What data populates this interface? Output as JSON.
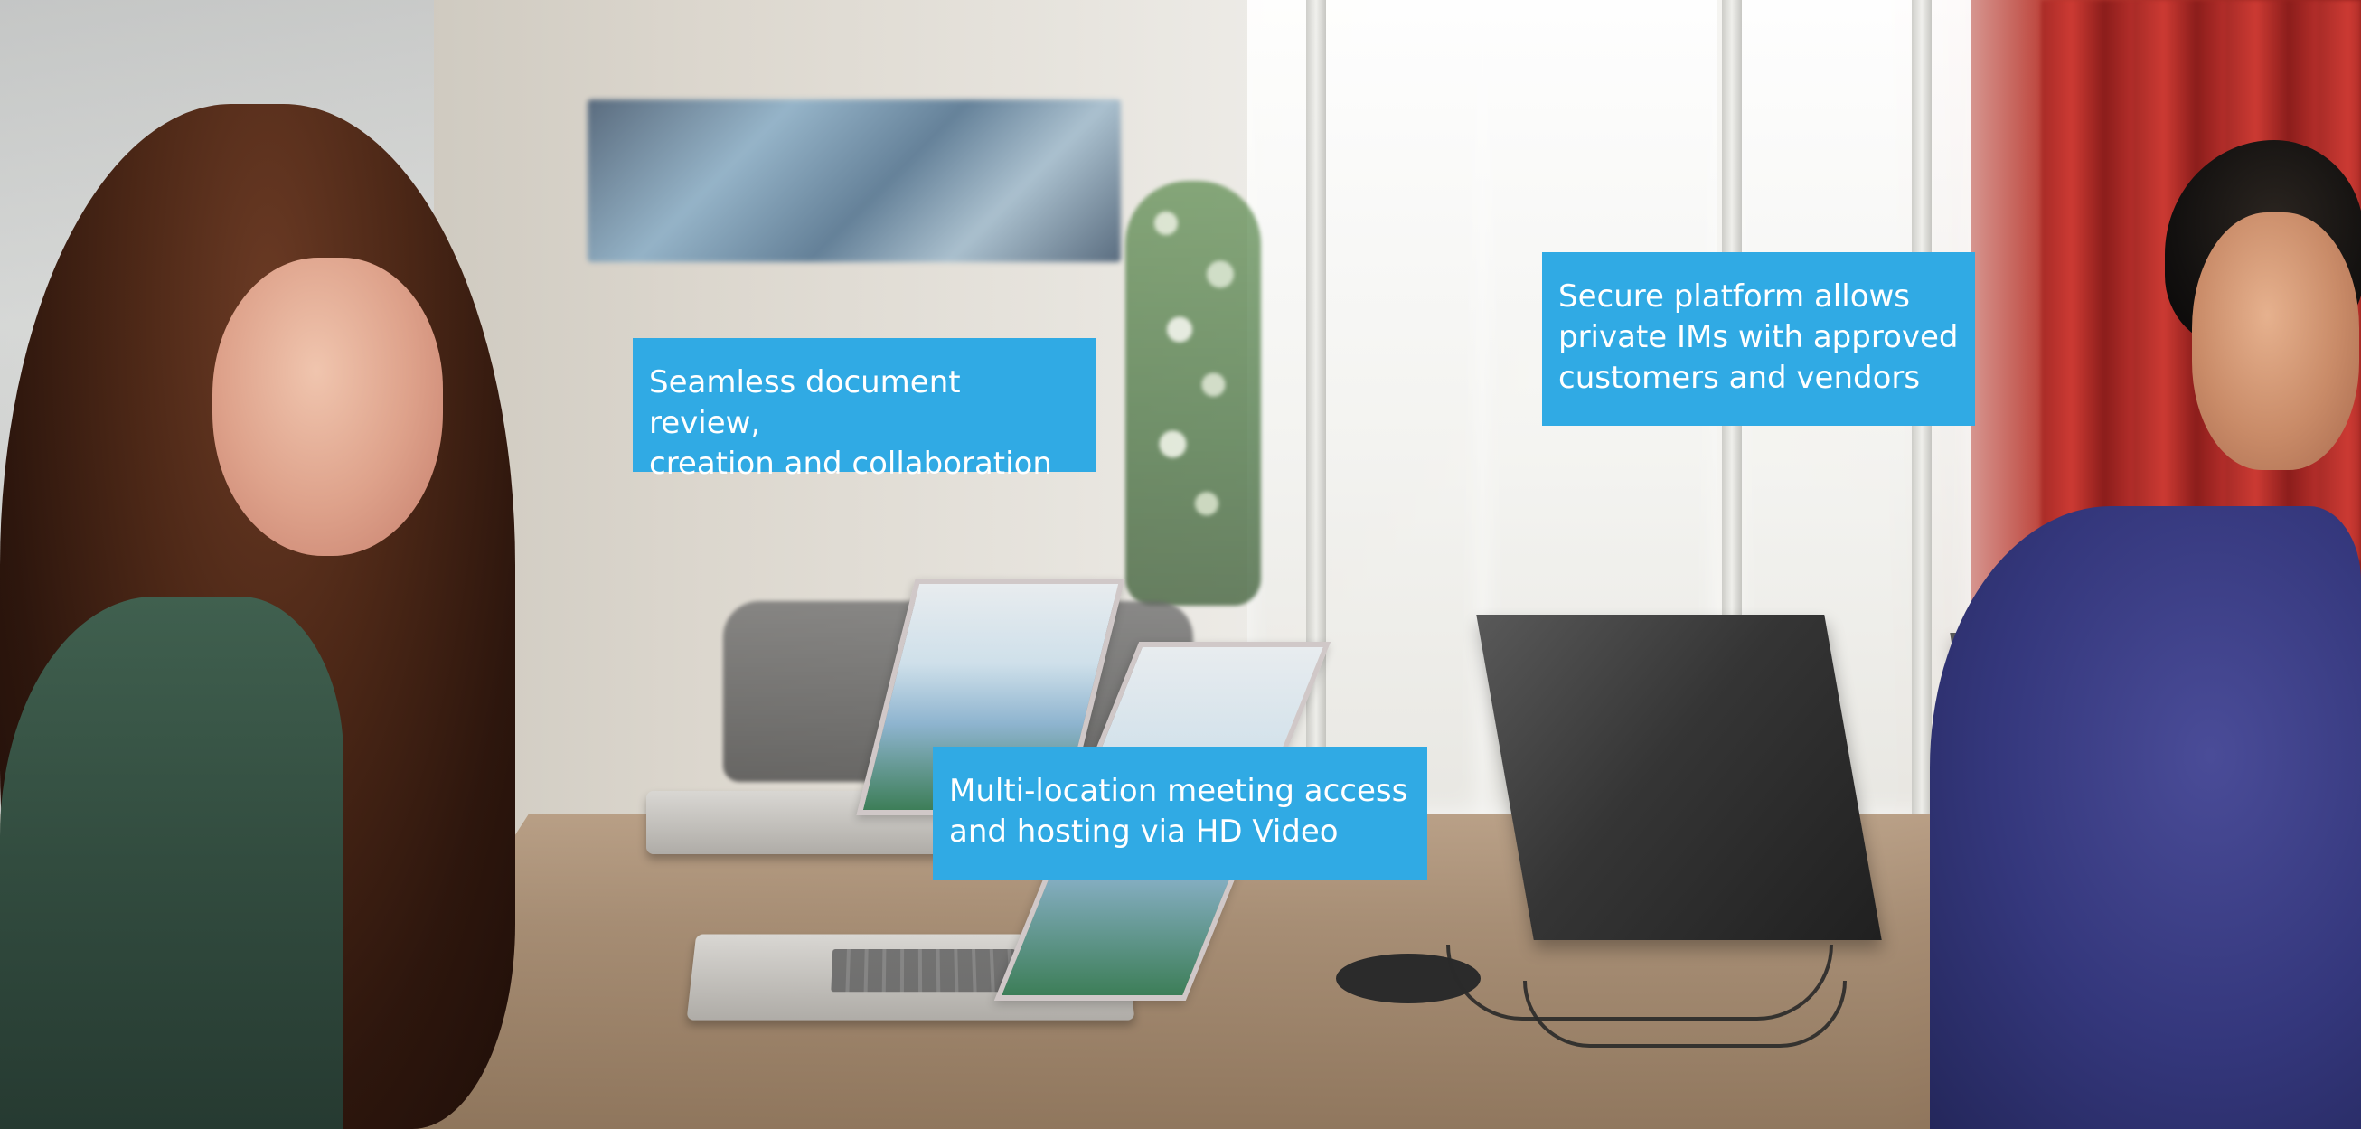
{
  "callouts": [
    {
      "lines": [
        "Seamless document review,",
        "creation and collaboration"
      ]
    },
    {
      "lines": [
        "Secure platform allows",
        "private IMs with approved",
        "customers and vendors"
      ]
    },
    {
      "lines": [
        "Multi-location meeting access",
        "and hosting via HD Video"
      ]
    }
  ],
  "colors": {
    "callout_background": "#30aae4",
    "callout_text": "#ffffff"
  }
}
